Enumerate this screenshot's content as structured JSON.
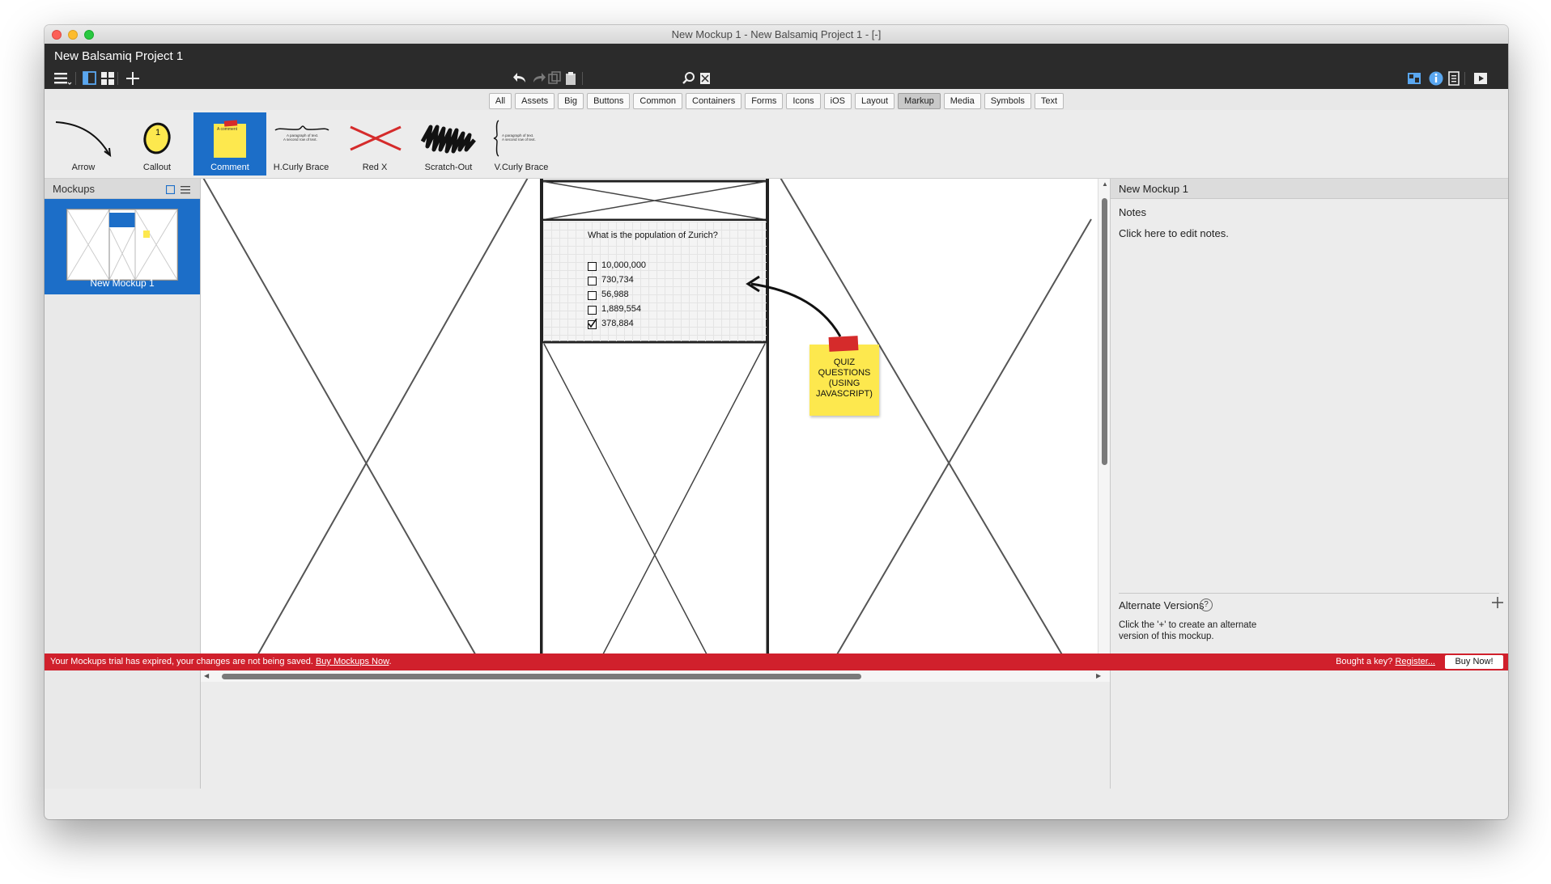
{
  "window": {
    "title": "New Mockup 1 - New Balsamiq Project 1 - [-]"
  },
  "header": {
    "project_title": "New Balsamiq Project 1"
  },
  "library_tabs": [
    "All",
    "Assets",
    "Big",
    "Buttons",
    "Common",
    "Containers",
    "Forms",
    "Icons",
    "iOS",
    "Layout",
    "Markup",
    "Media",
    "Symbols",
    "Text"
  ],
  "library_active_tab": "Markup",
  "controls": [
    {
      "label": "Arrow"
    },
    {
      "label": "Callout"
    },
    {
      "label": "Comment"
    },
    {
      "label": "H.Curly Brace"
    },
    {
      "label": "Red X"
    },
    {
      "label": "Scratch-Out"
    },
    {
      "label": "V.Curly Brace"
    }
  ],
  "control_thumb_text": {
    "comment": "A comment",
    "callout": "1",
    "paragraph_line1": "A paragraph of text.",
    "paragraph_line2": "A second row of text."
  },
  "sidebar": {
    "title": "Mockups",
    "items": [
      {
        "label": "New Mockup 1"
      }
    ]
  },
  "canvas": {
    "quiz": {
      "question": "What is the population of Zurich?",
      "options": [
        {
          "label": "10,000,000",
          "checked": false
        },
        {
          "label": "730,734",
          "checked": false
        },
        {
          "label": "56,988",
          "checked": false
        },
        {
          "label": "1,889,554",
          "checked": false
        },
        {
          "label": "378,884",
          "checked": true
        }
      ]
    },
    "sticky_note": {
      "text_lines": [
        "QUIZ",
        "QUESTIONS",
        "(USING",
        "JAVASCRIPT)"
      ],
      "color": "#fde84e"
    }
  },
  "right_panel": {
    "title": "New Mockup 1",
    "notes_label": "Notes",
    "notes_placeholder": "Click here to edit notes.",
    "alt_versions_label": "Alternate Versions",
    "alt_versions_help": "?",
    "alt_versions_hint_line1": "Click the '+' to create an alternate",
    "alt_versions_hint_line2": "version of this mockup."
  },
  "trial_bar": {
    "message": "Your Mockups trial has expired, your changes are not being saved.",
    "buy_link": "Buy Mockups Now",
    "message_end": ".",
    "key_question": "Bought a key?",
    "register_link": "Register...",
    "buy_button": "Buy Now!",
    "color": "#d0202c"
  },
  "colors": {
    "accent_blue": "#1c6ec8",
    "header_dark": "#2b2b2b"
  },
  "icons": [
    "menu-icon",
    "single-panel-icon",
    "grid-view-icon",
    "add-icon",
    "undo-icon",
    "redo-icon",
    "copy-icon",
    "paste-icon",
    "search-icon",
    "quick-add-icon",
    "navigator-icon",
    "info-icon",
    "notes-icon",
    "present-icon"
  ]
}
